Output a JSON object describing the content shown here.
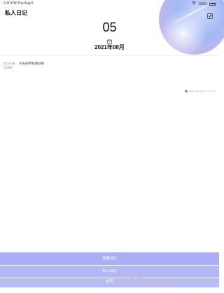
{
  "status_bar": {
    "time": "2:40 PM",
    "date": "Thu Aug 5",
    "battery": "100%"
  },
  "header": {
    "title": "私人日记",
    "edit_icon": "edit-icon"
  },
  "date_display": {
    "day": "05",
    "calendar_icon": "calendar-icon",
    "month": "2021年08月"
  },
  "entries": [
    {
      "date": "2021-08",
      "weekday": "星期四",
      "text": "今天的所有感好啦",
      "timestamp": "2021-08-05 14:40:09"
    }
  ],
  "bottom_buttons": {
    "button_1": "我要日记",
    "button_2": "私人日记",
    "button_3": "首页"
  },
  "watermark": {
    "main": "138",
    "sub": "DOWN"
  },
  "colors": {
    "accent": "#a8aef2",
    "weekday": "#9aa4dd"
  }
}
